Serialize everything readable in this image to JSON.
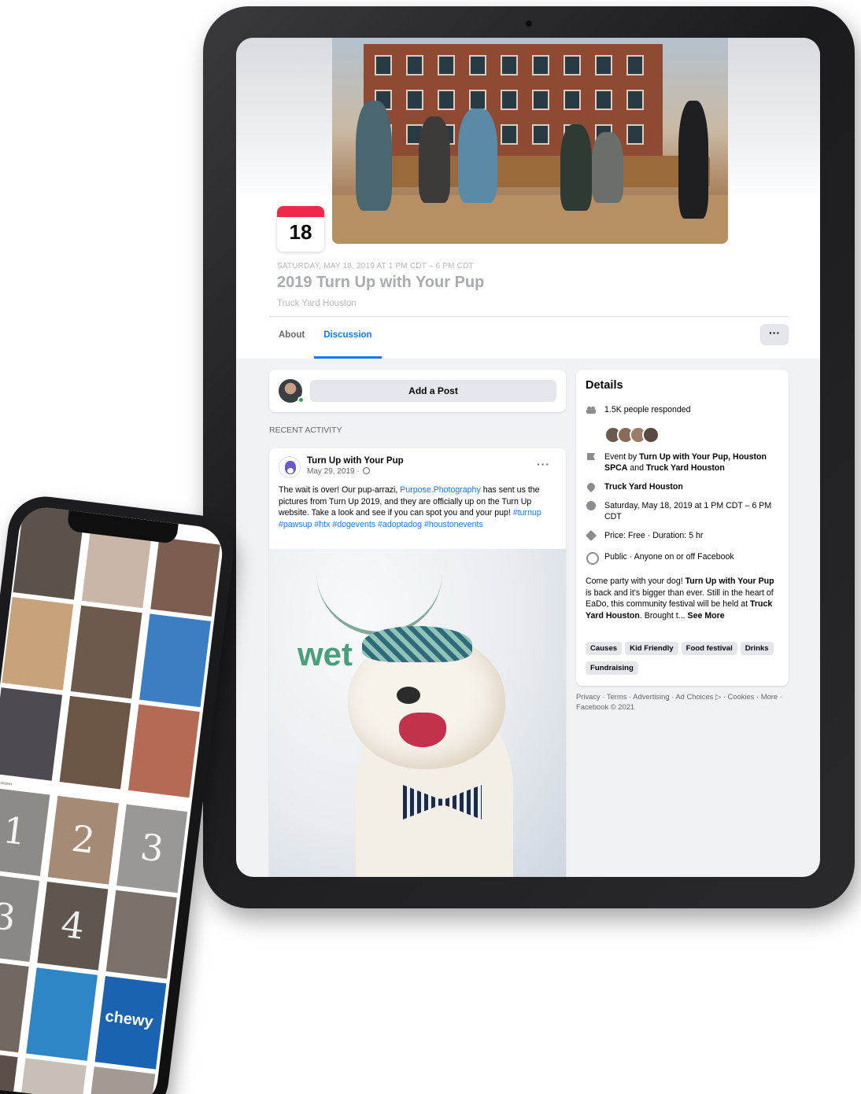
{
  "event": {
    "date_day": "18",
    "datetime": "SATURDAY, MAY 18, 2019 AT 1 PM CDT – 6 PM CDT",
    "title": "2019 Turn Up with Your Pup",
    "venue": "Truck Yard Houston"
  },
  "tabs": [
    {
      "label": "About",
      "active": false
    },
    {
      "label": "Discussion",
      "active": true
    }
  ],
  "more_button": "···",
  "composer": {
    "add_post_label": "Add a Post"
  },
  "recent_activity_label": "RECENT ACTIVITY",
  "post": {
    "author": "Turn Up with Your Pup",
    "date": "May 29, 2019 · ",
    "menu": "···",
    "text_before": "The wait is over! Our pup-arrazi, ",
    "mention": "Purpose.Photography",
    "text_after": " has sent us the pictures from Turn Up 2019, and they are officially up on the Turn Up website. Take a look and see if you can spot you and your pup! ",
    "hashtags": "#turnup #pawsup #htx #dogevents #adoptadog #houstonevents",
    "image_text": "wet"
  },
  "details": {
    "title": "Details",
    "responded": "1.5K people responded",
    "event_by_prefix": "Event by ",
    "event_by_names": "Turn Up with Your Pup, Houston SPCA",
    "event_by_and": " and ",
    "event_by_last": "Truck Yard Houston",
    "location": "Truck Yard Houston",
    "when": "Saturday, May 18, 2019 at 1 PM CDT – 6 PM CDT",
    "price": "Price: Free · Duration: 5 hr",
    "privacy": "Public · Anyone on or off Facebook",
    "desc_1": "Come party with your dog! ",
    "desc_bold_1": "Turn Up with Your Pup",
    "desc_2": " is back and it's bigger than ever. Still in the heart of EaDo, this community festival will be held at ",
    "desc_bold_2": "Truck Yard Houston",
    "desc_3": ". Brought t... ",
    "see_more": "See More",
    "chips": [
      "Causes",
      "Kid Friendly",
      "Food festival",
      "Drinks",
      "Fundraising"
    ]
  },
  "footer": "Privacy · Terms · Advertising · Ad Choices ▷ · Cookies · More · Facebook © 2021",
  "phone": {
    "tile_numbers": [
      "1",
      "2",
      "3",
      "3",
      "4"
    ],
    "section_label": "Most recent",
    "chewy_text": "chewy"
  },
  "colors": {
    "accent": "#1877f2",
    "calendar_red": "#f02849",
    "online_green": "#31a24c",
    "page_bg": "#f0f2f5"
  }
}
